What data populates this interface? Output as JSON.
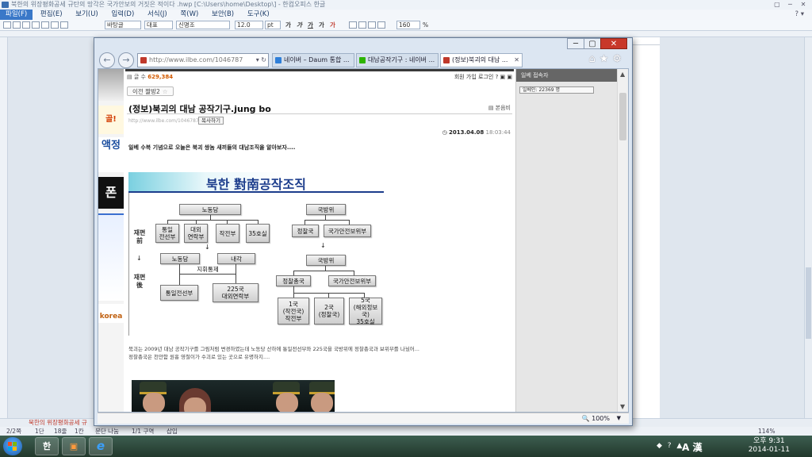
{
  "hwp": {
    "title": "북한의 위장평화공세 규탄의 망각은 국가안보의 거짓은 적이다 .hwp [C:\\Users\\home\\Desktop\\] - 한컴오피스 한글",
    "window_buttons": [
      "▢",
      "─",
      "✕"
    ],
    "menu": [
      {
        "label": "파일(F)",
        "active": true
      },
      {
        "label": "편집(E)",
        "active": false
      },
      {
        "label": "보기(U)",
        "active": false
      },
      {
        "label": "입력(D)",
        "active": false
      },
      {
        "label": "서식(J)",
        "active": false
      },
      {
        "label": "쪽(W)",
        "active": false
      },
      {
        "label": "보안(B)",
        "active": false
      },
      {
        "label": "도구(K)",
        "active": false
      }
    ],
    "menu_help": "? ▾",
    "toolbar": {
      "style": "바탕글",
      "lang": "대표",
      "font": "신명조",
      "size": "12.0",
      "unit": "pt",
      "format": [
        "가",
        "가",
        "가",
        "가",
        "가"
      ],
      "zoom": "160",
      "zoom_unit": "%"
    },
    "doc_tab": "북한의 위장평화공세 규",
    "status": {
      "page": "2/2쪽",
      "section": "1단",
      "line": "18줄",
      "col": "1칸",
      "break": "문단 나눔",
      "zone": "1/1 구역",
      "insert": "삽입",
      "zoom": "114%"
    }
  },
  "taskbar": {
    "apps": [
      {
        "name": "hangul-app",
        "glyph": "한"
      },
      {
        "name": "office-app",
        "glyph": "▣"
      },
      {
        "name": "ie-app",
        "glyph": "e"
      }
    ],
    "ime": "A 漢",
    "time": "오후 9:31",
    "date": "2014-01-11",
    "tray_icons": "◆ ? ▲"
  },
  "ie": {
    "window_buttons": [
      "─",
      "▢",
      "✕"
    ],
    "address": "http://www.ilbe.com/1046787",
    "address_btns": "▾ ↻",
    "tabs": [
      {
        "label": "네이버 – Daum 통합 ...",
        "icon_color": "#2f7fd8",
        "active": false
      },
      {
        "label": "대남공작기구 : 네이버 ...",
        "icon_color": "#2db400",
        "active": false
      },
      {
        "label": "(정보)북괴의 대남 ...",
        "icon_color": "#c0392b",
        "active": true
      }
    ],
    "tab_close": "✕",
    "commands": "⌂★⚙",
    "zoom": "100%",
    "zoom_icon": "🔍"
  },
  "ads": {
    "a1": "골!",
    "a2": "액정",
    "a3": "폰",
    "a4": "korea"
  },
  "post": {
    "count_label": "글 수",
    "count": "629,384",
    "member_links": "회원 가입    로그인",
    "prev_label": "이전 짤방2",
    "prev_star": "☆",
    "title": "(정보)북괴의 대남 공작기구.jung bo",
    "view_original": "본음비",
    "url": "http://www.ilbe.com/1046787540",
    "copy_label": "복사하기",
    "date": "2013.04.08",
    "time": "18:03:44",
    "intro": "일베 수복 기념으로 오늘은 북괴 쌍놈 새끼들의 대남조직을 알아보자....",
    "summary_line1": "북괴는 2009년 대남 공작기구를 그림처럼 변경하였는데 노동당 산하에 통일전선부와 225국을 국방위에 정찰총국과 보위부를 나눴어...",
    "summary_line2": "정찰총국은 천안함 원흉 영철이가 수괴로 있는 곳으로 유명하지...."
  },
  "chart": {
    "title": "북한 對南공작조직",
    "before": [
      "재편",
      "前"
    ],
    "after": [
      "재편",
      "後"
    ],
    "before_arrow": "↓",
    "party_before": "노동당",
    "party_units": [
      "통일\n전선부",
      "대외\n연락부",
      "작전부",
      "35호실"
    ],
    "defense_before": "국방위",
    "defense_units": [
      "정찰국",
      "국가안전보위부"
    ],
    "party_after": "노동당",
    "cabinet": "내각",
    "command_label": "지휘통제",
    "party_after_units": [
      "통일전선부",
      "225국\n대외연락부"
    ],
    "defense_after": "국방위",
    "defense_after_units": [
      "정찰총국",
      "국가안전보위부"
    ],
    "bureaus": [
      "1국\n(작전국)\n작전부",
      "2국\n(정찰국)",
      "5국\n(해외정보국)\n35호실"
    ]
  },
  "sidebar": {
    "header": "일베 접속자",
    "count_text": "일베인: 22369 명"
  }
}
